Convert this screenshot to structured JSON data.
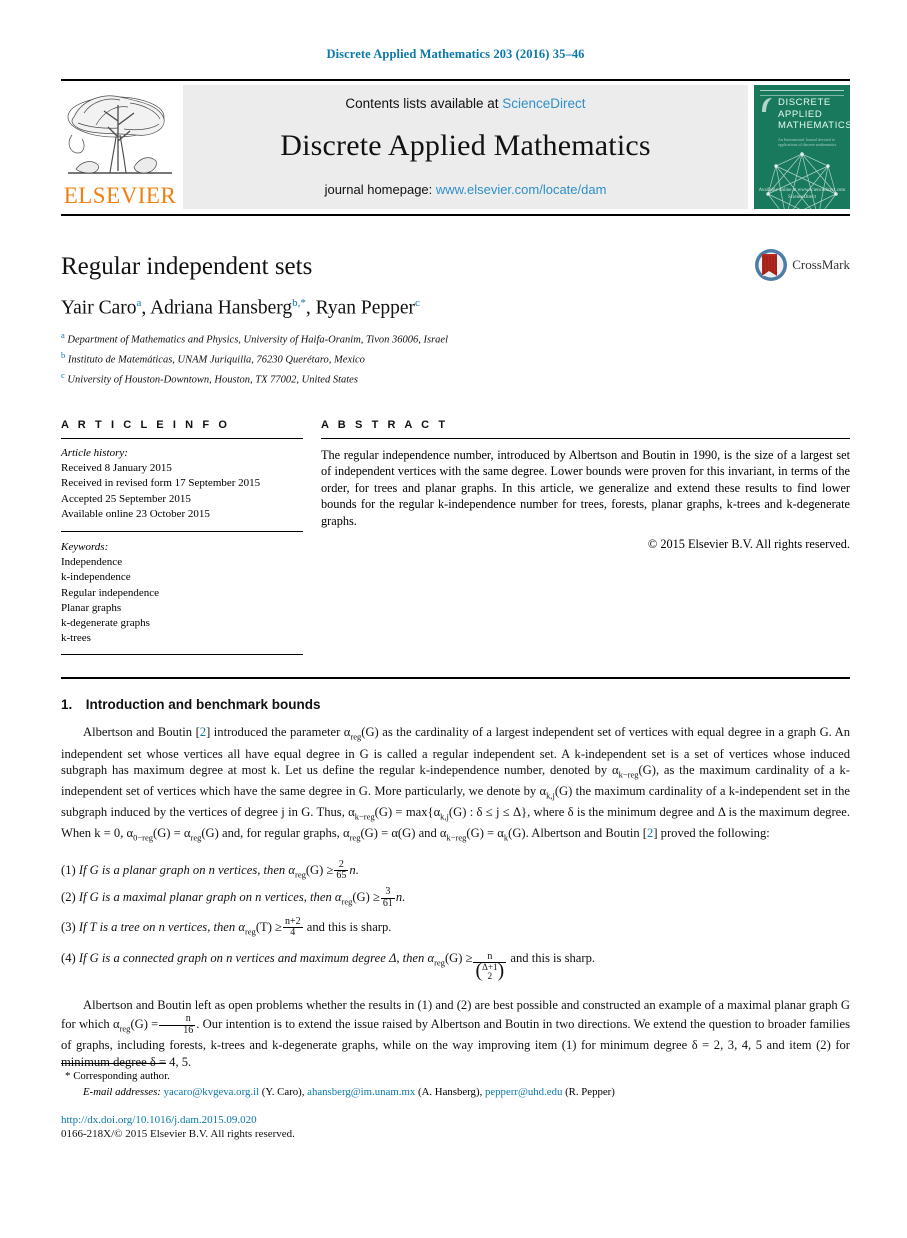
{
  "running_head": "Discrete Applied Mathematics 203 (2016) 35–46",
  "masthead": {
    "publisher_logo_text": "ELSEVIER",
    "contents_prefix": "Contents lists available at",
    "contents_link": "ScienceDirect",
    "journal_name": "Discrete Applied Mathematics",
    "homepage_prefix": "journal homepage:",
    "homepage_url": "www.elsevier.com/locate/dam",
    "cover": {
      "line1": "DISCRETE",
      "line2": "APPLIED",
      "line3": "MATHEMATICS",
      "small_print": "An International Journal devoted to applications of discrete mathematics",
      "foot1": "Available online at www.sciencedirect.com",
      "foot2": "ScienceDirect",
      "bg_color": "#19795d"
    }
  },
  "article": {
    "title": "Regular independent sets",
    "crossmark_label": "CrossMark",
    "authors": [
      {
        "name": "Yair Caro",
        "marks": "a"
      },
      {
        "name": "Adriana Hansberg",
        "marks": "b,*"
      },
      {
        "name": "Ryan Pepper",
        "marks": "c"
      }
    ],
    "affiliations": [
      {
        "mark": "a",
        "text": "Department of Mathematics and Physics, University of Haifa-Oranim, Tivon 36006, Israel"
      },
      {
        "mark": "b",
        "text": "Instituto de Matemáticas, UNAM Juriquilla, 76230 Querétaro, Mexico"
      },
      {
        "mark": "c",
        "text": "University of Houston-Downtown, Houston, TX 77002, United States"
      }
    ]
  },
  "article_info": {
    "heading": "A R T I C L E   I N F O",
    "history_label": "Article history:",
    "history": [
      "Received 8 January 2015",
      "Received in revised form 17 September 2015",
      "Accepted 25 September 2015",
      "Available online 23 October 2015"
    ],
    "keywords_label": "Keywords:",
    "keywords": [
      "Independence",
      "k-independence",
      "Regular independence",
      "Planar graphs",
      "k-degenerate graphs",
      "k-trees"
    ]
  },
  "abstract": {
    "heading": "A B S T R A C T",
    "text": "The regular independence number, introduced by Albertson and Boutin in 1990, is the size of a largest set of independent vertices with the same degree. Lower bounds were proven for this invariant, in terms of the order, for trees and planar graphs. In this article, we generalize and extend these results to find lower bounds for the regular k-independence number for trees, forests, planar graphs, k-trees and k-degenerate graphs.",
    "copyright": "© 2015 Elsevier B.V. All rights reserved."
  },
  "body": {
    "section_number": "1.",
    "section_title": "Introduction and benchmark bounds",
    "paragraph1_parts": {
      "p1": "Albertson and Boutin [",
      "ref1": "2",
      "p2": "] introduced the parameter α",
      "sub1": "reg",
      "p3": "(G) as the cardinality of a largest independent set of vertices with equal degree in a graph G. An independent set whose vertices all have equal degree in G is called a regular independent set. A k-independent set is a set of vertices whose induced subgraph has maximum degree at most k. Let us define the regular k-independence number, denoted by α",
      "sub2": "k−reg",
      "p4": "(G), as the maximum cardinality of a k-independent set of vertices which have the same degree in G. More particularly, we denote by α",
      "sub3": "k,j",
      "p5": "(G) the maximum cardinality of a k-independent set in the subgraph induced by the vertices of degree j in G. Thus, α",
      "sub4": "k−reg",
      "p6": "(G) = max{α",
      "sub5": "k,j",
      "p7": "(G) : δ ≤ j ≤ Δ}, where δ is the minimum degree and Δ is the maximum degree. When k = 0, α",
      "sub6": "0−reg",
      "p8": "(G) = α",
      "sub7": "reg",
      "p9": "(G) and, for regular graphs, α",
      "sub8": "reg",
      "p10": "(G) = α(G) and α",
      "sub9": "k−reg",
      "p11": "(G) = α",
      "sub10": "k",
      "p12": "(G). Albertson and Boutin [",
      "ref2": "2",
      "p13": "] proved the following:"
    },
    "list": [
      {
        "label": "(1)",
        "pre": "If G is a planar graph on n vertices, then α",
        "sub": "reg",
        "mid": "(G) ≥",
        "frac_num": "2",
        "frac_den": "65",
        "post": "n."
      },
      {
        "label": "(2)",
        "pre": "If G is a maximal planar graph on n vertices, then α",
        "sub": "reg",
        "mid": "(G) ≥",
        "frac_num": "3",
        "frac_den": "61",
        "post": "n."
      },
      {
        "label": "(3)",
        "pre": "If T is a tree on n vertices, then α",
        "sub": "reg",
        "mid": "(T) ≥",
        "frac_num": "n+2",
        "frac_den": "4",
        "post": "and this is sharp."
      },
      {
        "label": "(4)",
        "pre": "If G is a connected graph on n vertices and maximum degree Δ, then α",
        "sub": "reg",
        "mid": "(G) ≥",
        "frac_num": "n",
        "frac_den": "binom",
        "binom_top": "Δ+1",
        "binom_bottom": "2",
        "post": "and this is sharp."
      }
    ],
    "paragraph2_parts": {
      "p1": "Albertson and Boutin left as open problems whether the results in (1) and (2) are best possible and constructed an example of a maximal planar graph G for which α",
      "sub1": "reg",
      "p2": "(G) =",
      "frac_num": "n",
      "frac_den": "16",
      "p3": ". Our intention is to extend the issue raised by Albertson and Boutin in two directions. We extend the question to broader families of graphs, including forests, k-trees and k-degenerate graphs, while on the way improving item (1) for minimum degree δ = 2, 3, 4, 5 and item (2) for minimum degree δ = 4, 5."
    }
  },
  "footer": {
    "corresponding_star": "*",
    "corresponding_text": "Corresponding author.",
    "email_label": "E-mail addresses:",
    "emails": [
      {
        "address": "yacaro@kvgeva.org.il",
        "person": "(Y. Caro)"
      },
      {
        "address": "ahansberg@im.unam.mx",
        "person": "(A. Hansberg)"
      },
      {
        "address": "pepperr@uhd.edu",
        "person": "(R. Pepper)"
      }
    ],
    "doi": "http://dx.doi.org/10.1016/j.dam.2015.09.020",
    "issn_line": "0166-218X/© 2015 Elsevier B.V. All rights reserved."
  },
  "colors": {
    "link_blue": "#0b78ab",
    "sciencedirect_blue": "#2f8fc9",
    "elsevier_orange": "#f08010",
    "cover_green": "#19795d",
    "band_gray": "#ececec"
  }
}
